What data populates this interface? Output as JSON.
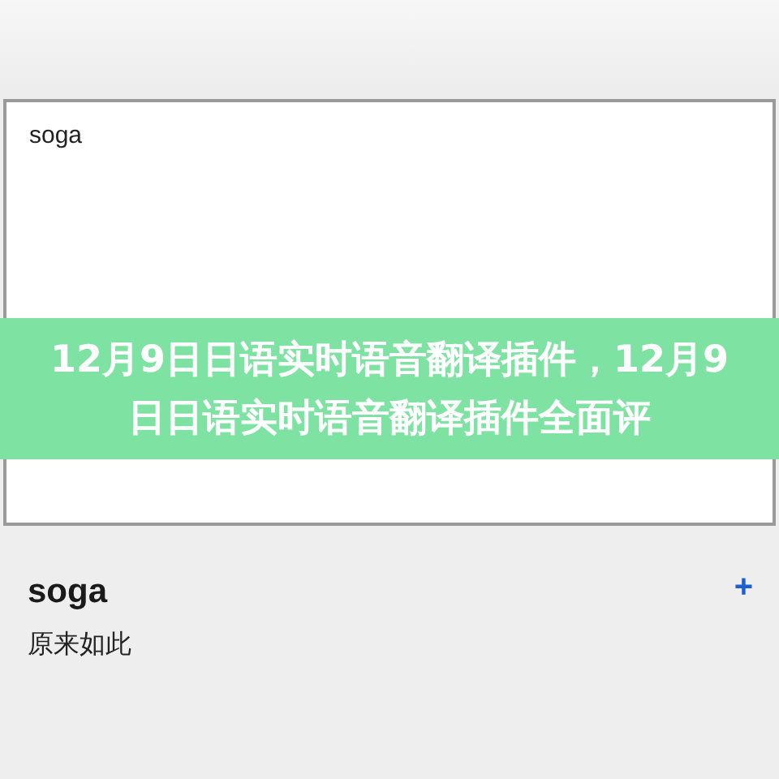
{
  "input_box": {
    "value": "soga"
  },
  "banner": {
    "title": "12月9日日语实时语音翻译插件，12月9日日语实时语音翻译插件全面评"
  },
  "result": {
    "word": "soga",
    "meaning": "原来如此",
    "add_button": "+"
  }
}
